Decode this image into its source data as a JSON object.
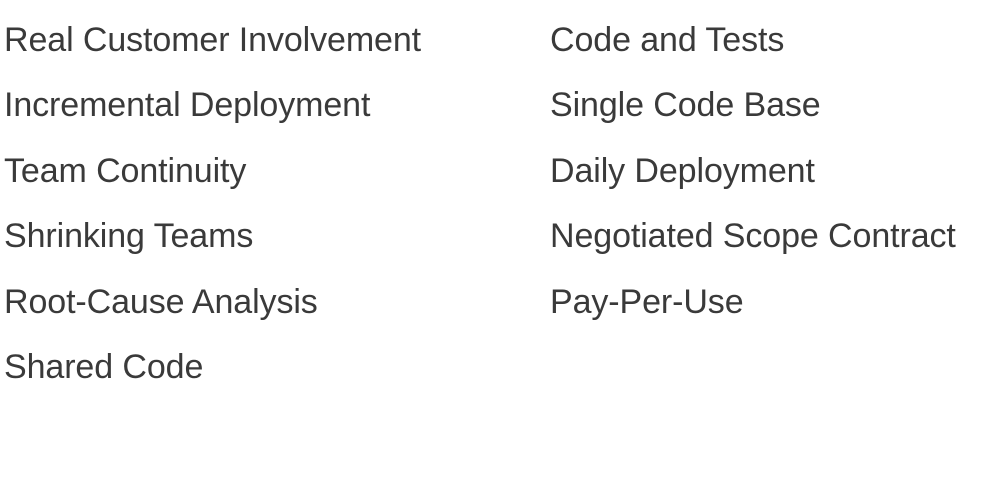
{
  "lists": {
    "left": [
      "Real Customer Involvement",
      "Incremental Deployment",
      "Team Continuity",
      "Shrinking Teams",
      "Root-Cause Analysis",
      "Shared Code"
    ],
    "right": [
      "Code and Tests",
      "Single Code Base",
      "Daily Deployment",
      "Negotiated Scope Contract",
      "Pay-Per-Use"
    ]
  }
}
